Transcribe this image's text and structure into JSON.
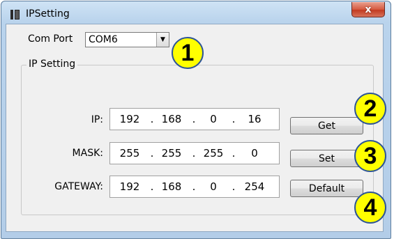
{
  "window": {
    "title": "IPSetting",
    "close_label": "x"
  },
  "com_port": {
    "label": "Com Port",
    "value": "COM6"
  },
  "group": {
    "title": "IP Setting"
  },
  "rows": [
    {
      "label": "IP:",
      "octets": [
        "192",
        "168",
        "0",
        "16"
      ],
      "button": "Get"
    },
    {
      "label": "MASK:",
      "octets": [
        "255",
        "255",
        "255",
        "0"
      ],
      "button": "Set"
    },
    {
      "label": "GATEWAY:",
      "octets": [
        "192",
        "168",
        "0",
        "254"
      ],
      "button": "Default"
    }
  ],
  "dot": ".",
  "badges": [
    "1",
    "2",
    "3",
    "4"
  ],
  "colors": {
    "badge_fill": "#ffff00",
    "badge_border": "#2e5597",
    "close": "#c23a20"
  }
}
